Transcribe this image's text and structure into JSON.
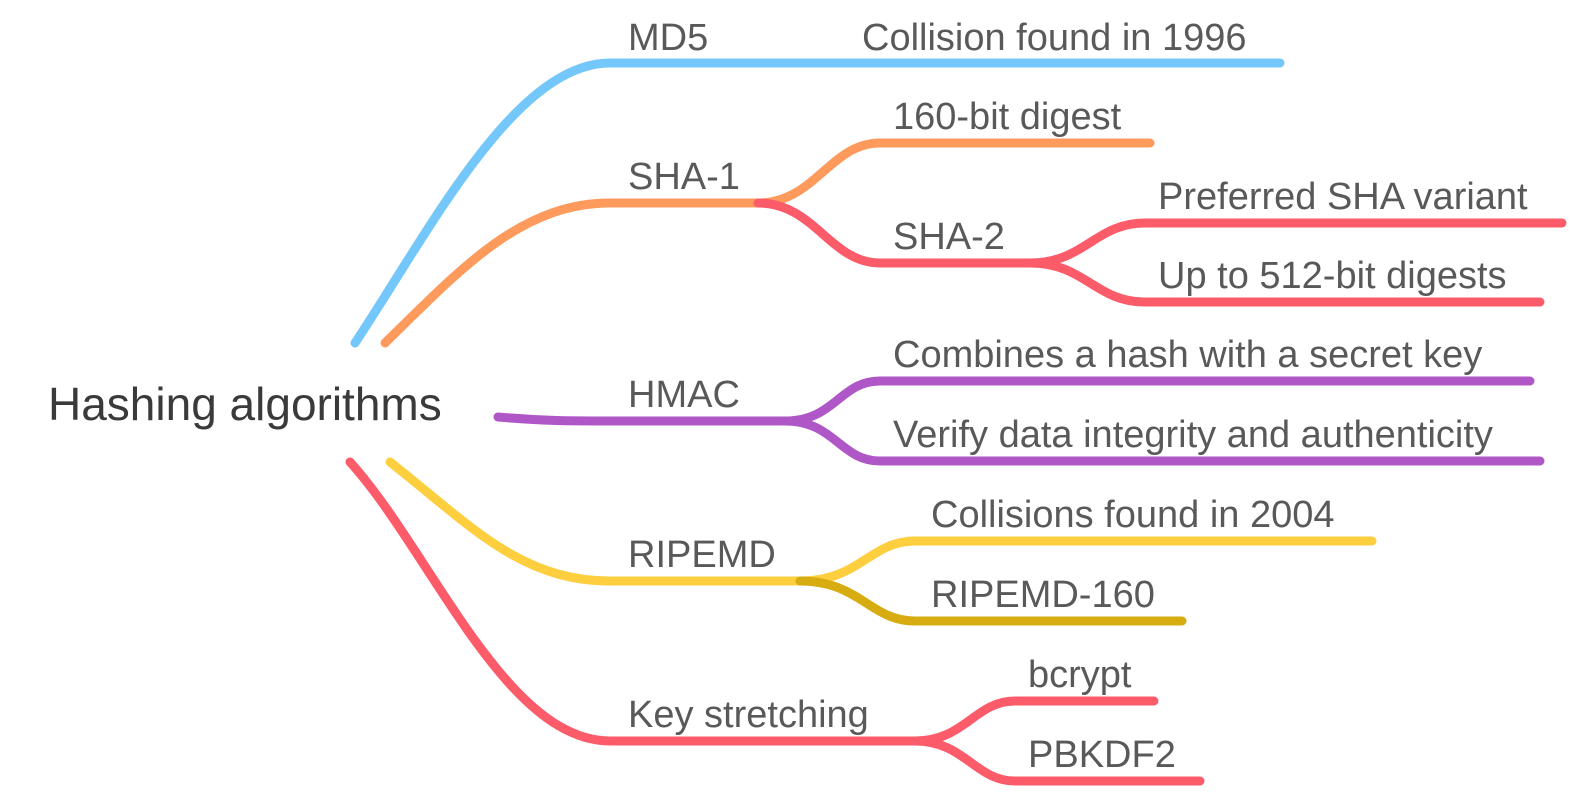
{
  "root": {
    "label": "Hashing algorithms"
  },
  "colors": {
    "md5": "#74c7fb",
    "sha1": "#fd9a5c",
    "sha2": "#fc5b6a",
    "hmac": "#b057c7",
    "ripemd": "#fdce3e",
    "ripemd160": "#d7ac10",
    "keystretch": "#fc5b6a",
    "text": "#595959"
  },
  "branches": {
    "md5": {
      "label": "MD5",
      "child": "Collision found in 1996"
    },
    "sha1": {
      "label": "SHA-1",
      "child": "160-bit digest",
      "sha2": {
        "label": "SHA-2",
        "children": [
          "Preferred SHA variant",
          "Up to 512-bit digests"
        ]
      }
    },
    "hmac": {
      "label": "HMAC",
      "children": [
        "Combines a hash with a secret key",
        "Verify data integrity and authenticity"
      ]
    },
    "ripemd": {
      "label": "RIPEMD",
      "children": [
        "Collisions found in 2004",
        "RIPEMD-160"
      ]
    },
    "keystretch": {
      "label": "Key stretching",
      "children": [
        "bcrypt",
        "PBKDF2"
      ]
    }
  }
}
